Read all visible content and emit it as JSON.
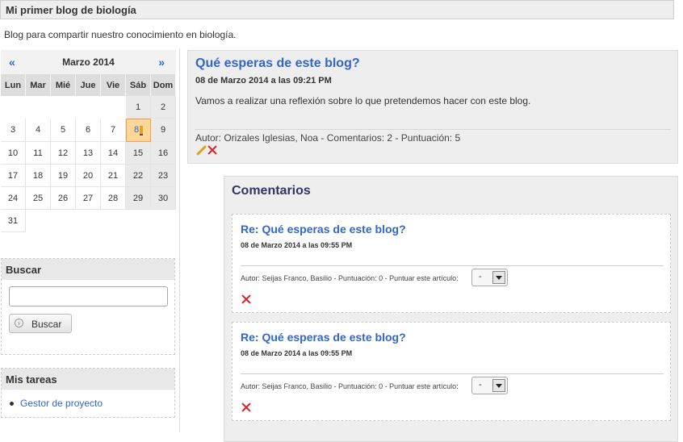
{
  "blog": {
    "title": "Mi primer blog de biología",
    "subtitle": "Blog para compartir nuestro conocimiento en biología."
  },
  "calendar": {
    "prev": "«",
    "next": "»",
    "month": "Marzo 2014",
    "weekdays": [
      "Lun",
      "Mar",
      "Mié",
      "Jue",
      "Vie",
      "Sáb",
      "Dom"
    ],
    "days": [
      "1",
      "2",
      "3",
      "4",
      "5",
      "6",
      "7",
      "8",
      "9",
      "10",
      "11",
      "12",
      "13",
      "14",
      "15",
      "16",
      "17",
      "18",
      "19",
      "20",
      "21",
      "22",
      "23",
      "24",
      "25",
      "26",
      "27",
      "28",
      "29",
      "30",
      "31"
    ],
    "today": "8"
  },
  "search": {
    "title": "Buscar",
    "input_value": "",
    "button": "Buscar"
  },
  "tasks": {
    "title": "Mis tareas",
    "items": [
      "Gestor de proyecto"
    ]
  },
  "post": {
    "title": "Qué esperas de este blog?",
    "date": "08 de Marzo 2014 a las 09:21 PM",
    "body": "Vamos a realizar una reflexión sobre lo que pretendemos hacer con este blog.",
    "meta": "Autor: Orizales Iglesias, Noa - Comentarios: 2 - Puntuación: 5"
  },
  "comments": {
    "title": "Comentarios",
    "items": [
      {
        "title": "Re: Qué esperas de este blog?",
        "date": "08 de Marzo 2014 a las 09:55 PM",
        "meta": "Autor: Seijas Franco, Basilio - Puntuación: 0 - Puntuar este artículo:",
        "rating": "-"
      },
      {
        "title": "Re: Qué esperas de este blog?",
        "date": "08 de Marzo 2014 a las 09:55 PM",
        "meta": "Autor: Seijas Franco, Basilio - Puntuación: 0 - Puntuar este artículo:",
        "rating": "-"
      }
    ]
  }
}
